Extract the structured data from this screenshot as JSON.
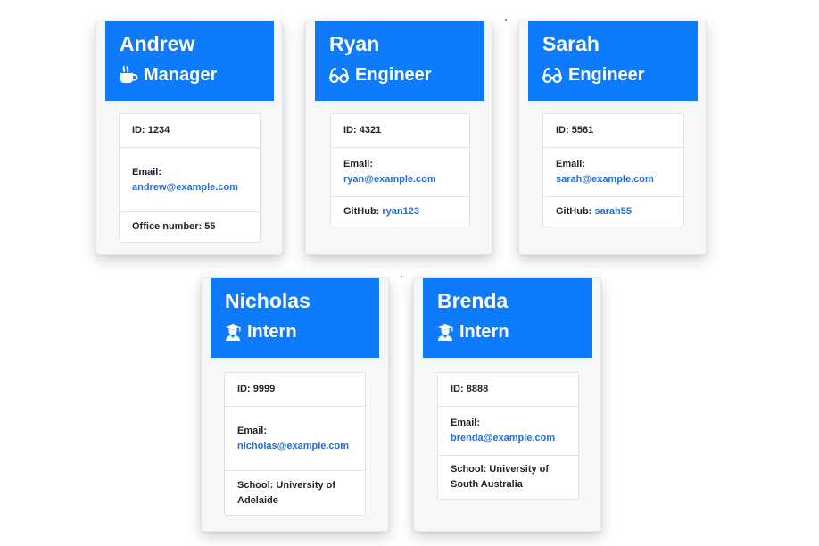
{
  "employees": [
    {
      "name": "Andrew",
      "role": "Manager",
      "role_icon": "coffee-cup-icon",
      "id_label": "ID:",
      "id": "1234",
      "email_label": "Email:",
      "email": "andrew@example.com",
      "extra_label": "Office number:",
      "extra_value": "55"
    },
    {
      "name": "Ryan",
      "role": "Engineer",
      "role_icon": "glasses-icon",
      "id_label": "ID:",
      "id": "4321",
      "email_label": "Email:",
      "email": "ryan@example.com",
      "extra_label": "GitHub:",
      "extra_value": "ryan123"
    },
    {
      "name": "Sarah",
      "role": "Engineer",
      "role_icon": "glasses-icon",
      "id_label": "ID:",
      "id": "5561",
      "email_label": "Email:",
      "email": "sarah@example.com",
      "extra_label": "GitHub:",
      "extra_value": "sarah55"
    },
    {
      "name": "Nicholas",
      "role": "Intern",
      "role_icon": "graduate-icon",
      "id_label": "ID:",
      "id": "9999",
      "email_label": "Email:",
      "email": "nicholas@example.com",
      "extra_label": "School:",
      "extra_value": "University of Adelaide"
    },
    {
      "name": "Brenda",
      "role": "Intern",
      "role_icon": "graduate-icon",
      "id_label": "ID:",
      "id": "8888",
      "email_label": "Email:",
      "email": "brenda@example.com",
      "extra_label": "School:",
      "extra_value": "University of South Australia"
    }
  ],
  "colors": {
    "header_bg": "#0d7bfb",
    "link": "#1f6fe0",
    "card_bg": "#f6f7f9"
  }
}
